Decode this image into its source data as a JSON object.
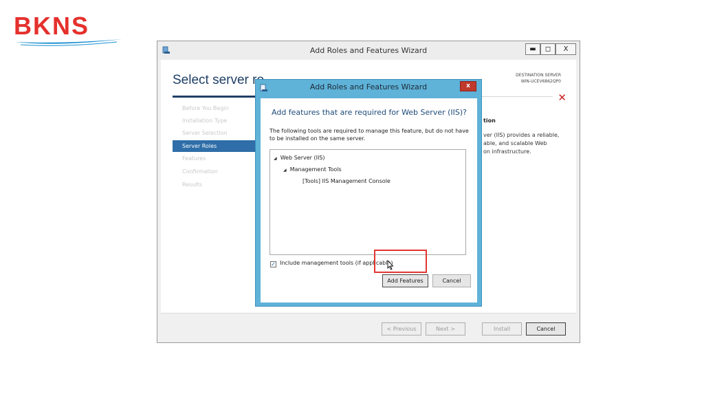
{
  "brand": {
    "logo_text": "BKNS",
    "logo_color": "#e5302c",
    "swoosh_color": "#1a8fd1"
  },
  "wizard": {
    "window_title": "Add Roles and Features Wizard",
    "page_title": "Select server ro",
    "destination_label": "DESTINATION SERVER",
    "destination_server": "WIN-UCEV6862QP0",
    "window_controls": {
      "minimize": "▬",
      "maximize": "◻",
      "close": "X"
    },
    "nav": [
      {
        "label": "Before You Begin",
        "active": false
      },
      {
        "label": "Installation Type",
        "active": false
      },
      {
        "label": "Server Selection",
        "active": false
      },
      {
        "label": "Server Roles",
        "active": true
      },
      {
        "label": "Features",
        "active": false
      },
      {
        "label": "Confirmation",
        "active": false
      },
      {
        "label": "Results",
        "active": false
      }
    ],
    "description_heading": "tion",
    "description_lines": [
      "ver (IIS) provides a reliable,",
      "able, and scalable Web",
      "on infrastructure."
    ],
    "buttons": {
      "previous": "< Previous",
      "next": "Next >",
      "install": "Install",
      "cancel": "Cancel"
    }
  },
  "dialog": {
    "title": "Add Roles and Features Wizard",
    "close_label": "x",
    "heading": "Add features that are required for Web Server (IIS)?",
    "description": "The following tools are required to manage this feature, but do not have to be installed on the same server.",
    "tree": [
      {
        "label": "Web Server (IIS)",
        "level": 0,
        "expanded": true
      },
      {
        "label": "Management Tools",
        "level": 1,
        "expanded": true
      },
      {
        "label": "[Tools] IIS Management Console",
        "level": 2,
        "expanded": false
      }
    ],
    "include_tools_label": "Include management tools (if applicable)",
    "include_tools_checked": true,
    "add_features_label": "Add Features",
    "cancel_label": "Cancel",
    "highlight_color": "#e0352f"
  }
}
